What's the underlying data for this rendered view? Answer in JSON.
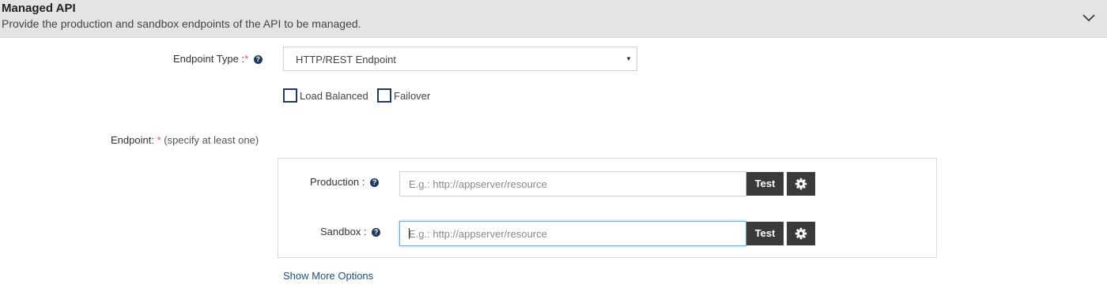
{
  "header": {
    "title": "Managed API",
    "subtitle": "Provide the production and sandbox endpoints of the API to be managed.",
    "collapse_icon": "chevron-down-icon"
  },
  "endpoint_type": {
    "label": "Endpoint Type :",
    "required_mark": "*",
    "help_icon": "question-circle-icon",
    "selected_value": "HTTP/REST Endpoint"
  },
  "options": [
    {
      "label": "Load Balanced",
      "checked": false
    },
    {
      "label": "Failover",
      "checked": false
    }
  ],
  "endpoint": {
    "label": "Endpoint:",
    "required_mark": "*",
    "hint": "(specify at least one)"
  },
  "production": {
    "label": "Production :",
    "placeholder": "E.g.: http://appserver/resource",
    "value": "",
    "test_label": "Test",
    "settings_icon": "gear-icon"
  },
  "sandbox": {
    "label": "Sandbox :",
    "placeholder": "E.g.: http://appserver/resource",
    "value": "",
    "test_label": "Test",
    "settings_icon": "gear-icon"
  },
  "more_options_link": "Show More Options",
  "colors": {
    "header_bg": "#e4e4e4",
    "button_bg": "#3a3a3a",
    "required": "#d9534f",
    "help_icon": "#1f3a5f",
    "link": "#1f4e79",
    "focus_border": "#66afe9"
  }
}
